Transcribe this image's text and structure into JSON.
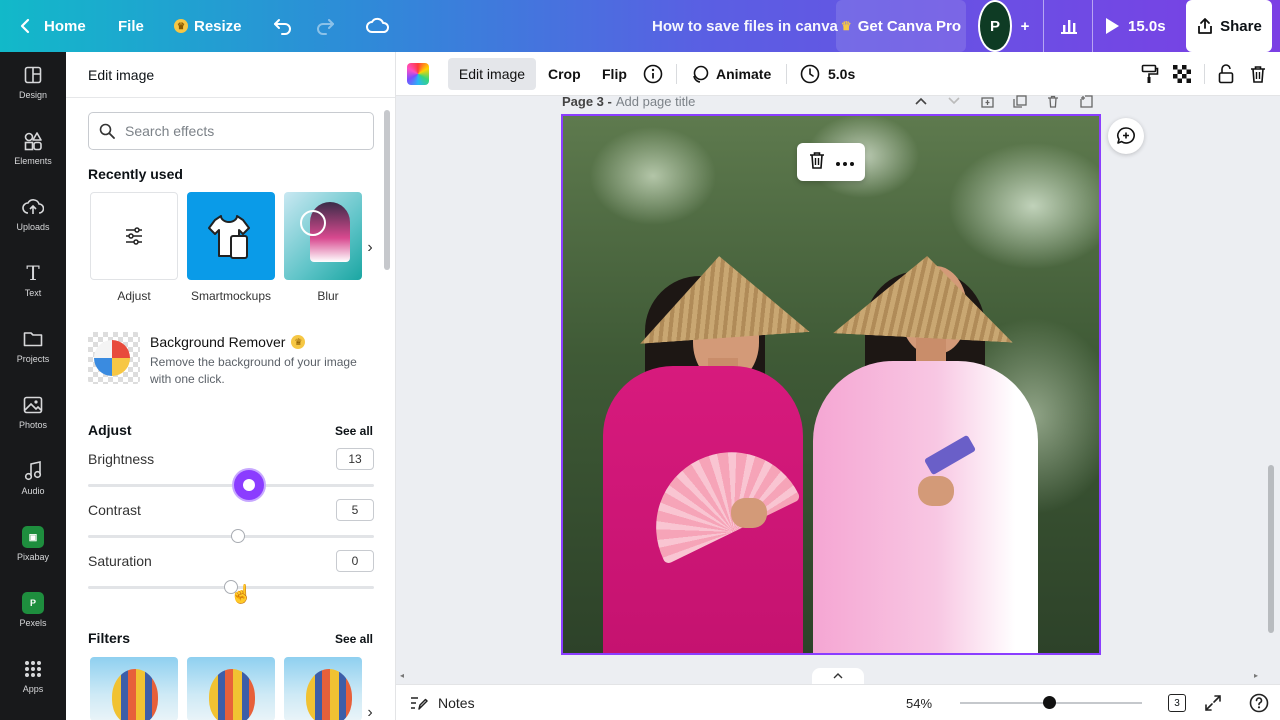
{
  "topbar": {
    "home": "Home",
    "file": "File",
    "resize": "Resize",
    "doc_title": "How to save files in canva",
    "pro": "Get Canva Pro",
    "avatar_initial": "P",
    "duration": "15.0s",
    "share": "Share"
  },
  "rail": [
    {
      "label": "Design",
      "icon": "design-icon"
    },
    {
      "label": "Elements",
      "icon": "elements-icon"
    },
    {
      "label": "Uploads",
      "icon": "uploads-icon"
    },
    {
      "label": "Text",
      "icon": "text-icon"
    },
    {
      "label": "Projects",
      "icon": "projects-icon"
    },
    {
      "label": "Photos",
      "icon": "photos-icon"
    },
    {
      "label": "Audio",
      "icon": "audio-icon"
    },
    {
      "label": "Pixabay",
      "icon": "pixabay-icon"
    },
    {
      "label": "Pexels",
      "icon": "pexels-icon"
    },
    {
      "label": "Apps",
      "icon": "apps-icon"
    }
  ],
  "panel": {
    "title": "Edit image",
    "search_placeholder": "Search effects",
    "recently_used": "Recently used",
    "recent": {
      "adjust": "Adjust",
      "smartmockups": "Smartmockups",
      "blur": "Blur"
    },
    "bg_remover": {
      "title": "Background Remover",
      "desc": "Remove the background of your image with one click."
    },
    "adjust": {
      "title": "Adjust",
      "see_all": "See all",
      "brightness_label": "Brightness",
      "brightness": "13",
      "contrast_label": "Contrast",
      "contrast": "5",
      "saturation_label": "Saturation",
      "saturation": "0"
    },
    "filters": {
      "title": "Filters",
      "see_all": "See all"
    }
  },
  "context_toolbar": {
    "edit_image": "Edit image",
    "crop": "Crop",
    "flip": "Flip",
    "animate": "Animate",
    "duration": "5.0s"
  },
  "page": {
    "number": "Page 3 -",
    "add_title": "Add page title"
  },
  "bottom": {
    "notes": "Notes",
    "zoom": "54%",
    "zoom_fraction": 0.54,
    "page_count": "3"
  },
  "colors": {
    "accent": "#8b3dff",
    "rail": "#18191b",
    "smartmockups": "#0a9be8"
  }
}
